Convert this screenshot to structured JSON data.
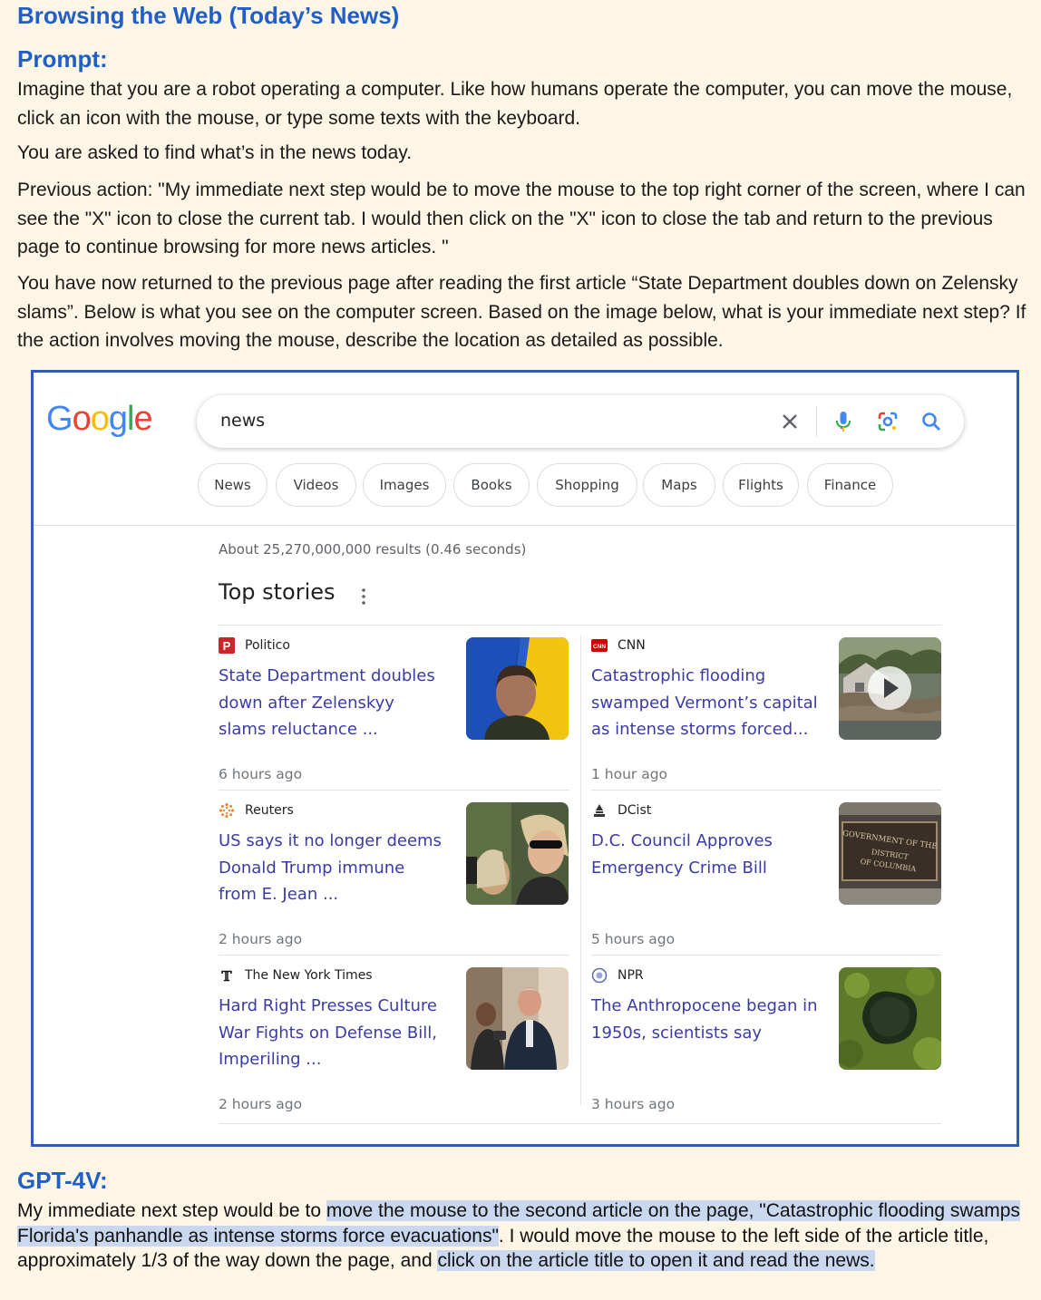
{
  "page_title": "Browsing the Web (Today’s News)",
  "prompt_heading": "Prompt:",
  "prompt_paragraphs": [
    "Imagine that you are a robot operating a computer. Like how humans operate the computer, you can move the mouse, click an icon with the mouse, or type some texts with the keyboard.",
    "You are asked to find what’s in the news today.",
    "Previous action: \"My immediate next step would be to move the mouse to the top right corner of the screen, where I can see the \"X\" icon to close the current tab. I would then click on the \"X\" icon to close the tab and return to the previous page to continue browsing for more news articles. \"",
    "You have now returned to the previous page after reading the first article “State Department doubles down on Zelensky slams”. Below is what you see on the computer screen. Based on the image below, what is your immediate next step? If the action involves moving the mouse, describe the location as detailed as possible."
  ],
  "google": {
    "logo_letters": [
      "G",
      "o",
      "o",
      "g",
      "l",
      "e"
    ],
    "search_value": "news",
    "chips": [
      "News",
      "Videos",
      "Images",
      "Books",
      "Shopping",
      "Maps",
      "Flights",
      "Finance"
    ],
    "result_stats": "About 25,270,000,000 results (0.46 seconds)",
    "top_stories_title": "Top stories",
    "stories": [
      {
        "source": "Politico",
        "headline": "State Department doubles down after Zelenskyy slams reluctance ...",
        "age": "6 hours ago"
      },
      {
        "source": "CNN",
        "headline": "Catastrophic flooding swamped Vermont’s capital as intense storms forced...",
        "age": "1 hour ago"
      },
      {
        "source": "Reuters",
        "headline": "US says it no longer deems Donald Trump immune from E. Jean ...",
        "age": "2 hours ago"
      },
      {
        "source": "DCist",
        "headline": "D.C. Council Approves Emergency Crime Bill",
        "age": "5 hours ago"
      },
      {
        "source": "The New York Times",
        "headline": "Hard Right Presses Culture War Fights on Defense Bill, Imperiling ...",
        "age": "2 hours ago"
      },
      {
        "source": "NPR",
        "headline": "The Anthropocene began in 1950s, scientists say",
        "age": "3 hours ago"
      }
    ],
    "politico_icon_letter": "P",
    "cnn_icon_text": "CNN",
    "nyt_icon_glyph": "𝕋",
    "dc_plaque_text": [
      "GOVERNMENT OF THE",
      "DISTRICT",
      "OF COLUMBIA"
    ]
  },
  "response_heading": "GPT-4V:",
  "response": {
    "p1": "My immediate next step would be to ",
    "h1": "move the mouse to the second article on the page, \"Catastrophic flooding swamps Florida's panhandle as intense storms force evacuations\"",
    "p2": ". I would move the mouse to the left side of the article title, approximately 1/3 of the way down the page, and ",
    "h2": "click on the article title to open it and read the news.",
    "p3": ""
  }
}
